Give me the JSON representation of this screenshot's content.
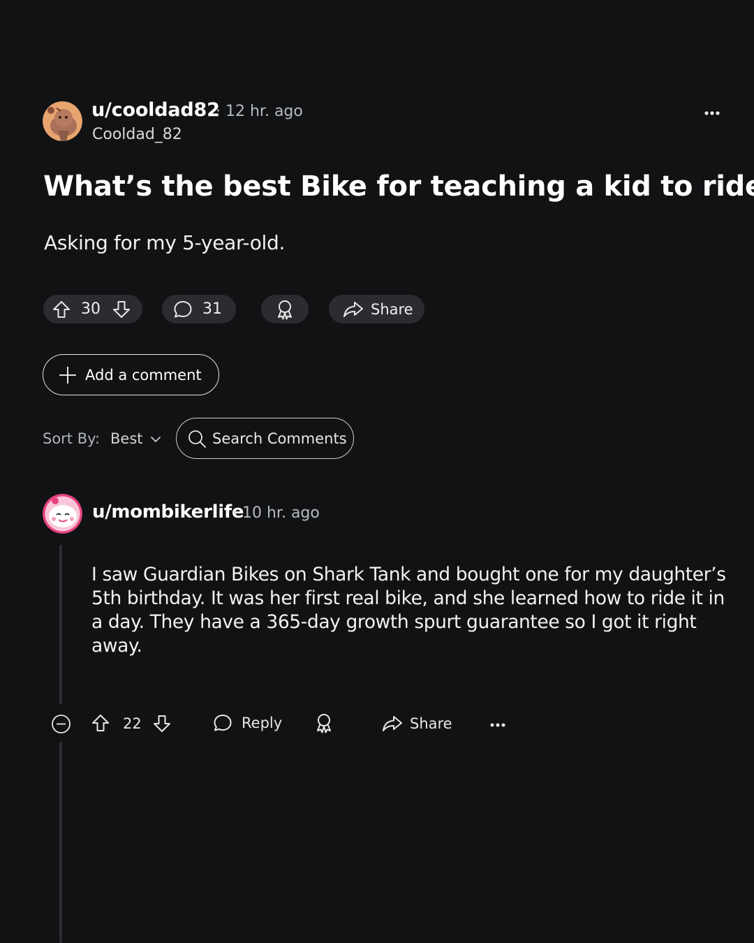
{
  "post": {
    "username": "u/cooldad82",
    "meta_separator": "·",
    "time_ago": "12 hr. ago",
    "display_name": "Cooldad_82",
    "title": "What’s the best Bike for teaching a kid to ride?",
    "body": "Asking for my 5-year-old.",
    "upvotes": "30",
    "comments": "31",
    "share_label": "Share"
  },
  "composer": {
    "add_comment_label": "Add a comment"
  },
  "sort": {
    "label": "Sort By:",
    "value": "Best"
  },
  "search": {
    "placeholder": "Search Comments"
  },
  "comment": {
    "username": "u/mombikerlife",
    "meta_separator": "·",
    "time_ago": "10 hr. ago",
    "body_lines": [
      "I saw Guardian Bikes on Shark Tank and bought one for my daughter’s",
      "5th birthday. It was her first real bike, and she learned how to ride it in",
      "a day. They have a 365-day growth spurt guarantee so I got it right away."
    ],
    "upvotes": "22",
    "reply_label": "Reply",
    "share_label": "Share"
  },
  "colors": {
    "background": "#111214",
    "pill": "#2a2c2f",
    "muted_text": "#b7babd",
    "thread_line": "#2b2d30"
  },
  "icons": [
    "snoo-avatar-icon",
    "more-icon",
    "upvote-icon",
    "downvote-icon",
    "comment-icon",
    "award-icon",
    "share-icon",
    "plus-icon",
    "chevron-down-icon",
    "search-icon",
    "collapse-icon"
  ]
}
